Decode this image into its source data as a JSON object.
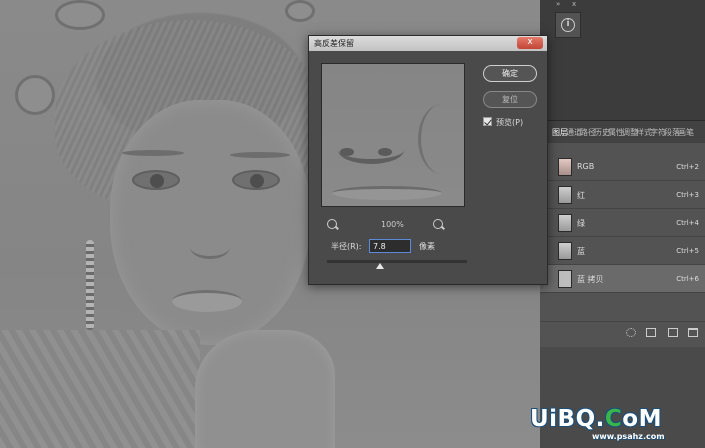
{
  "dialog": {
    "title": "高反差保留",
    "close_glyph": "x",
    "ok_label": "确定",
    "reset_label": "复位",
    "preview_label": "预览(P)",
    "preview_checked": true,
    "zoom_percent": "100%",
    "radius_label": "半径(R):",
    "radius_value": "7.8",
    "radius_unit": "像素"
  },
  "info_panel": {
    "expand_glyph": "»",
    "close_glyph": "x",
    "info_glyph": "i"
  },
  "channels_panel": {
    "tabs": [
      "图层",
      "通道",
      "路径",
      "历史",
      "属性",
      "调整",
      "样式",
      "字符",
      "段落",
      "画笔"
    ],
    "rows": [
      {
        "name": "RGB",
        "shortcut": "Ctrl+2"
      },
      {
        "name": "红",
        "shortcut": "Ctrl+3"
      },
      {
        "name": "绿",
        "shortcut": "Ctrl+4"
      },
      {
        "name": "蓝",
        "shortcut": "Ctrl+5"
      },
      {
        "name": "蓝 拷贝",
        "shortcut": "Ctrl+6"
      }
    ]
  },
  "watermark": {
    "main_a": "UiBQ.",
    "main_b": "C",
    "main_c": "oM",
    "sub": "www.psahz.com"
  },
  "colors": {
    "accent_blue": "#5b8bd6",
    "close_red": "#c24536",
    "watermark_green": "#39b54a"
  }
}
